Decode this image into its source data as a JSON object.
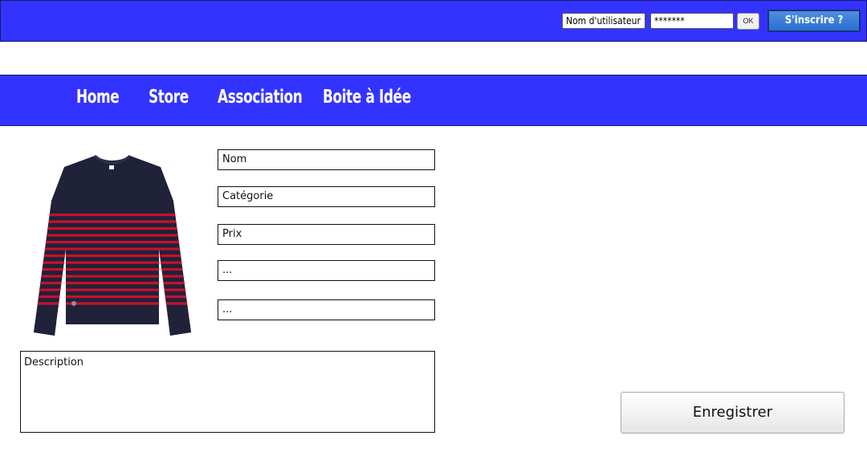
{
  "header": {
    "username_value": "Nom d'utilisateur",
    "password_value": "*******",
    "ok_label": "OK",
    "signup_label": "S'inscrire ?"
  },
  "nav": {
    "items": [
      {
        "label": "Home"
      },
      {
        "label": "Store"
      },
      {
        "label": "Association"
      },
      {
        "label": "Boite à Idée"
      }
    ]
  },
  "product": {
    "image_icon": "sweater-image",
    "colors": {
      "navy": "#1f2238",
      "stripe": "#c8102e"
    }
  },
  "form": {
    "fields": [
      {
        "value": "Nom"
      },
      {
        "value": "Catégorie"
      },
      {
        "value": "Prix"
      },
      {
        "value": "..."
      },
      {
        "value": "..."
      }
    ],
    "description_value": "Description",
    "save_label": "Enregistrer"
  },
  "colors": {
    "accent": "#3333ff",
    "button_blue": "#3a7ad8"
  }
}
